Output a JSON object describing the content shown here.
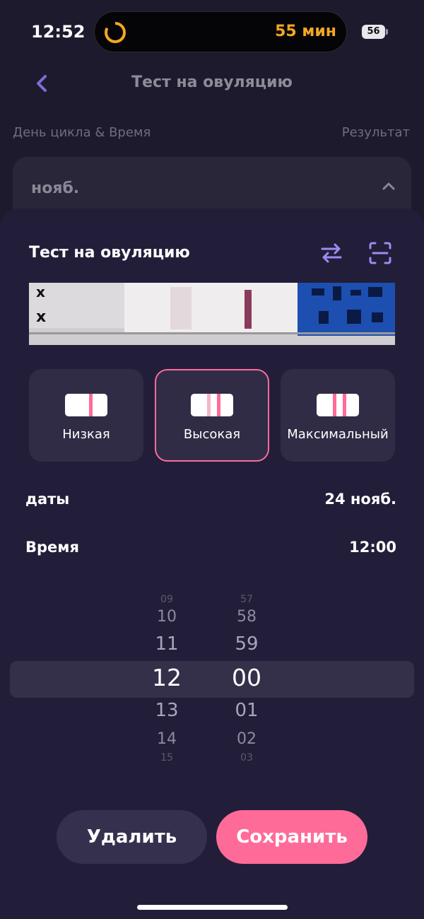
{
  "status_bar": {
    "time": "12:52",
    "timer_text": "55 мин",
    "battery": "56"
  },
  "header": {
    "title": "Тест на овуляцию"
  },
  "columns": {
    "left": "День цикла & Время",
    "right": "Результат"
  },
  "month_card": {
    "label": "нояб."
  },
  "sheet": {
    "title": "Тест на овуляцию",
    "levels": [
      {
        "label": "Низкая",
        "selected": false
      },
      {
        "label": "Высокая",
        "selected": true
      },
      {
        "label": "Максимальный",
        "selected": false
      }
    ],
    "date_label": "даты",
    "date_value": "24 нояб.",
    "time_label": "Время",
    "time_value": "12:00",
    "picker": {
      "hours": [
        "09",
        "10",
        "11",
        "12",
        "13",
        "14",
        "15"
      ],
      "minutes": [
        "57",
        "58",
        "59",
        "00",
        "01",
        "02",
        "03"
      ]
    },
    "delete_label": "Удалить",
    "save_label": "Сохранить"
  },
  "colors": {
    "accent": "#ff6b98",
    "timer": "#f5a623",
    "icon_purple": "#9c8cf0"
  }
}
